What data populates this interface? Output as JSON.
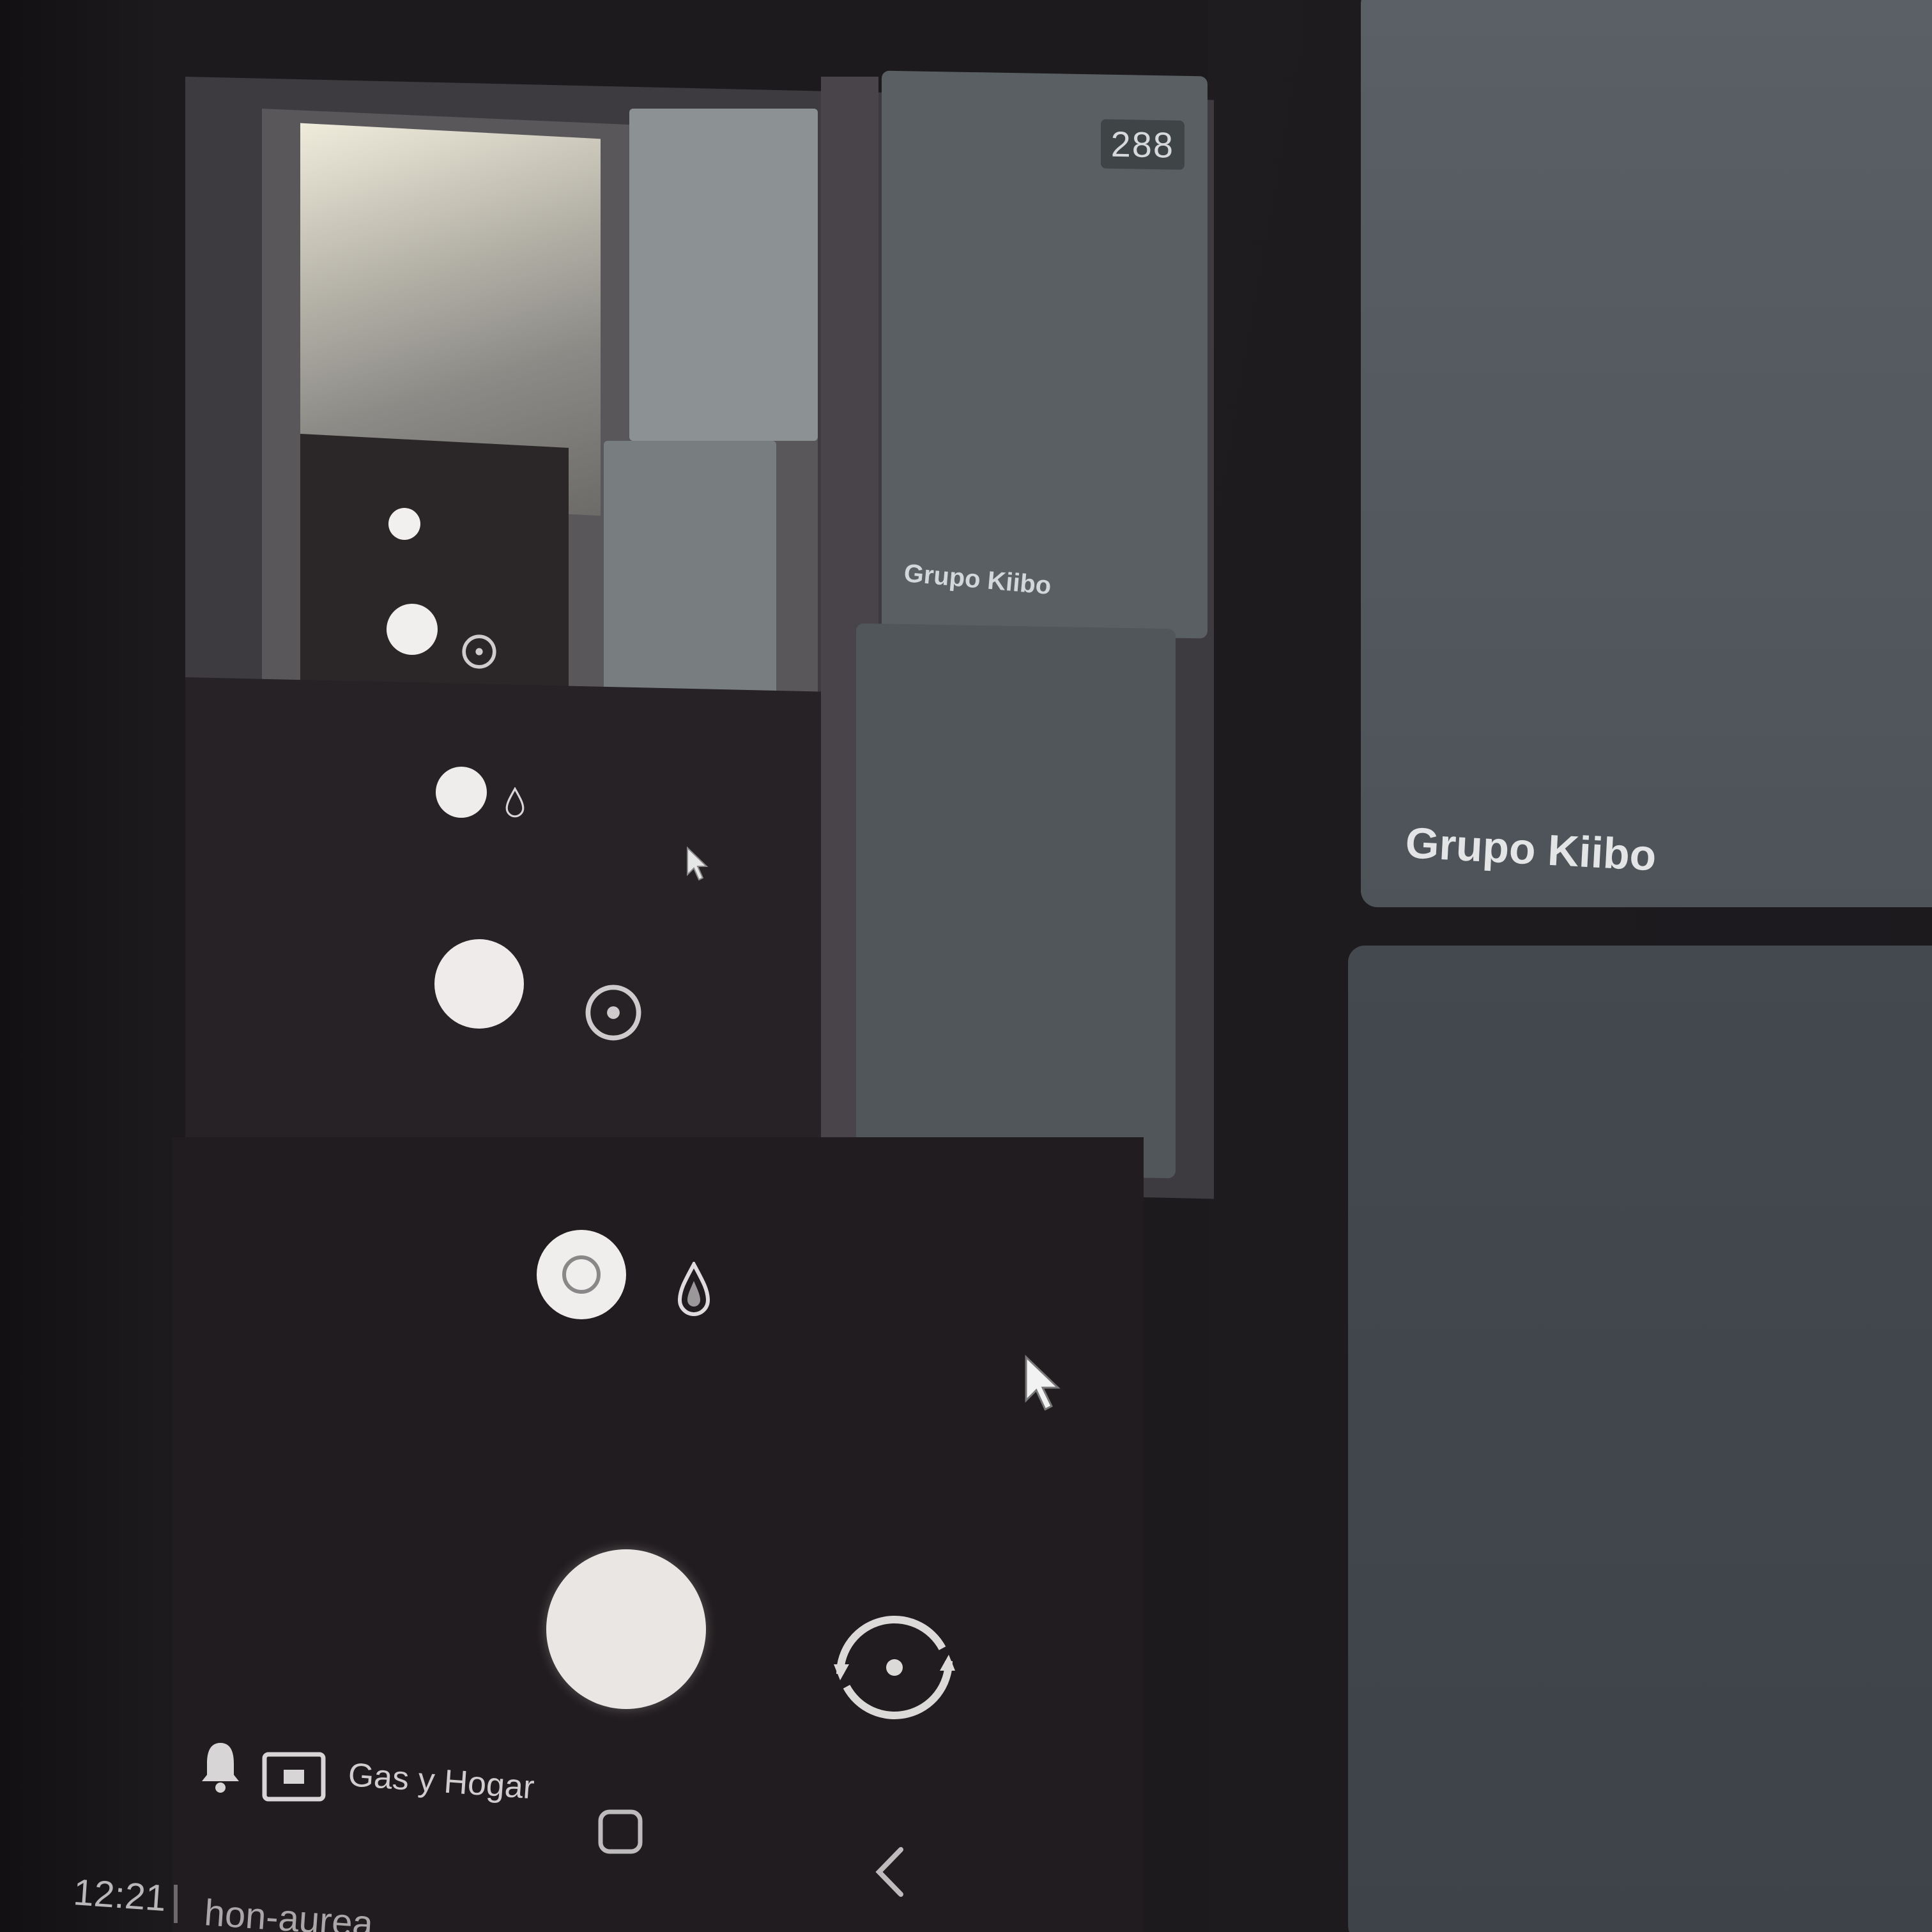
{
  "tile": {
    "title": "Grupo Kiibo",
    "count_badge": "288"
  },
  "camera_bar": {
    "app_label": "Gas y Hogar"
  },
  "taskbar": {
    "time": "12:21",
    "text": "hon-aurea"
  },
  "icons": {
    "mode": "camera-mode-icon",
    "drop": "drop-icon",
    "shutter": "shutter-icon",
    "flip": "flip-camera-icon",
    "cursor": "cursor-icon",
    "bell": "bell-icon",
    "screen": "screen-cast-icon",
    "square": "square-icon",
    "back": "back-chevron-icon"
  },
  "colors": {
    "background": "#1c1a1c",
    "panel_gray": "#5a6066",
    "panel_dark_gray": "#43494f",
    "shutter_white": "#e9e6e4",
    "text_light": "#e2e4e6"
  }
}
